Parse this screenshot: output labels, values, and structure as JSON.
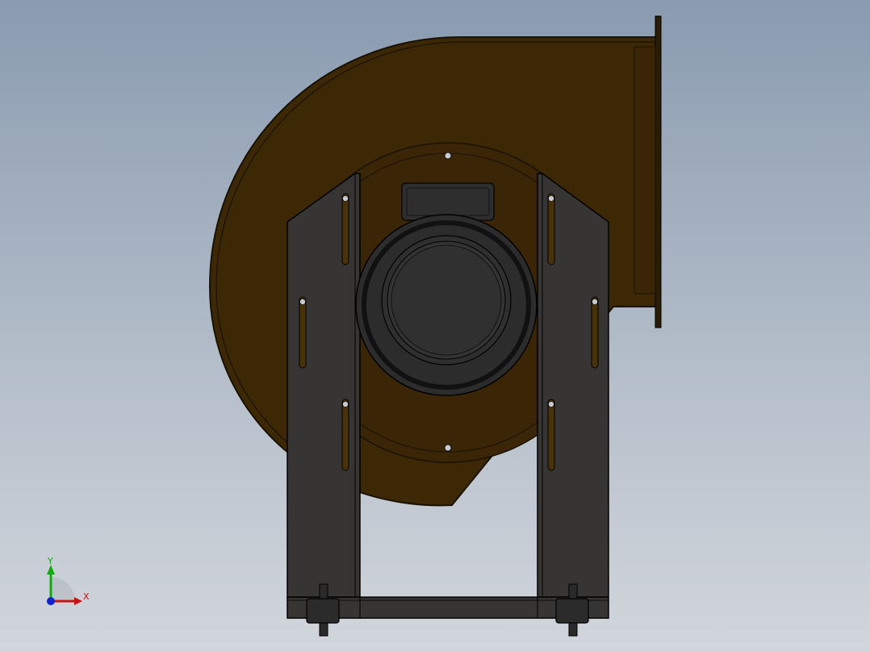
{
  "viewport": {
    "background_top": "#8a9bb0",
    "background_bottom": "#d2d6dc"
  },
  "model": {
    "description_name": "centrifugal-fan-assembly",
    "housing_color": "#3d2806",
    "housing_edge_color": "#1a1103",
    "frame_color": "#363533",
    "motor_color": "#2c2c2c",
    "edge_color": "#000000"
  },
  "triad": {
    "x_label": "X",
    "y_label": "Y",
    "x_color": "#cc1111",
    "y_color": "#11aa11",
    "z_color": "#1122cc"
  }
}
